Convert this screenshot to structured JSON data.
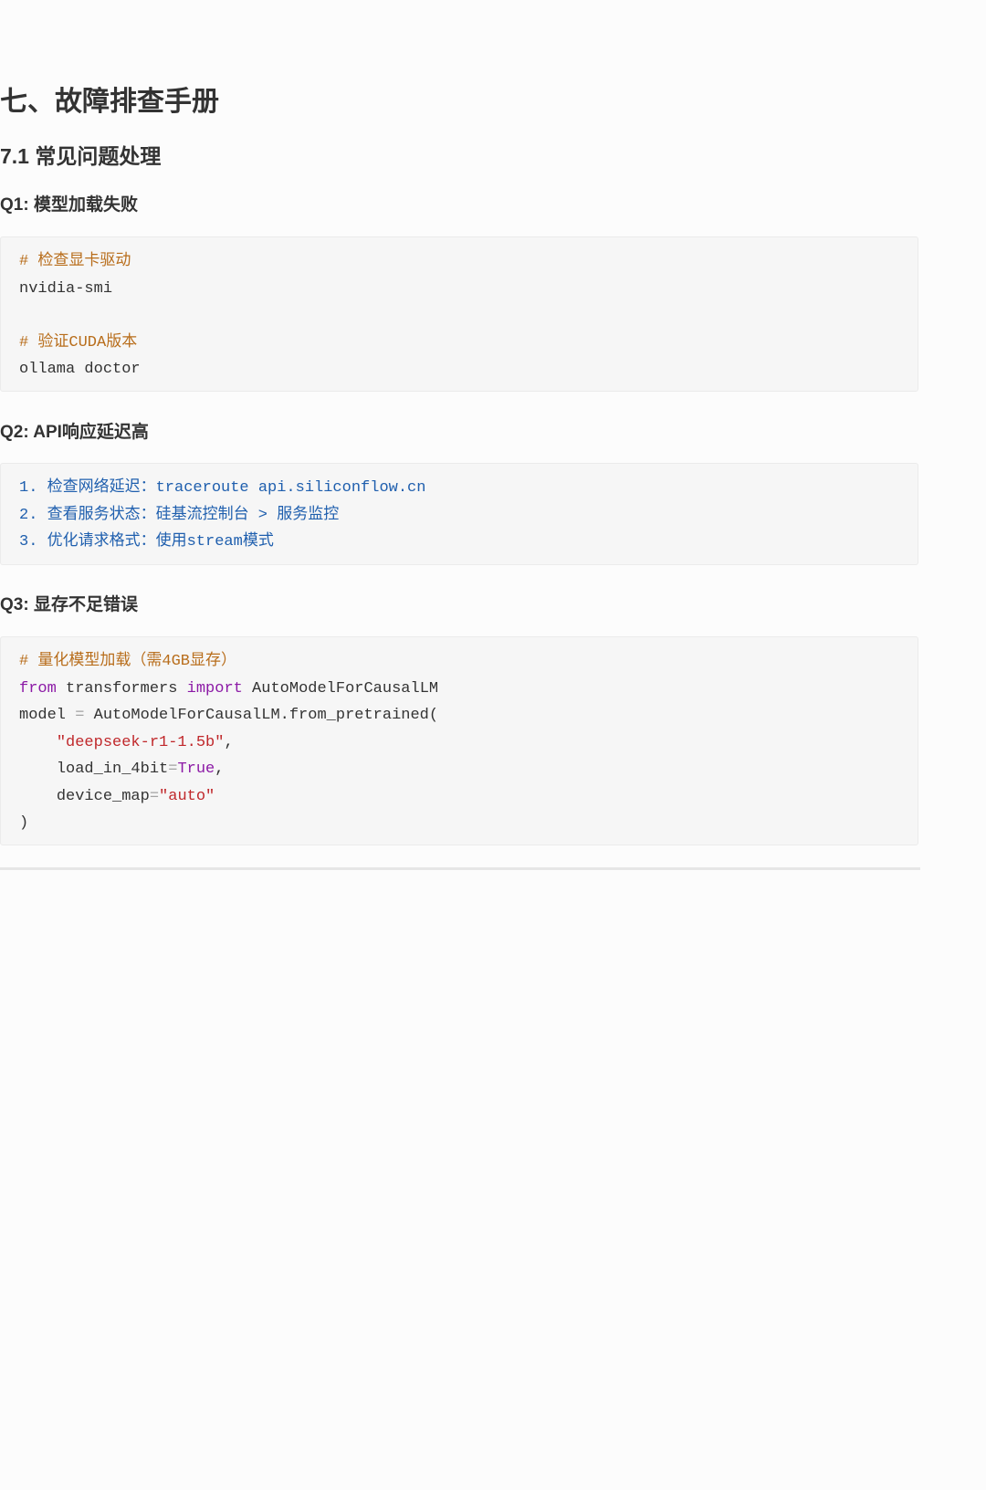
{
  "title": "七、故障排查手册",
  "section": "7.1 常见问题处理",
  "q1": {
    "heading": "Q1: 模型加载失败",
    "lines": [
      "# 检查显卡驱动",
      "nvidia-smi",
      "",
      "# 验证CUDA版本",
      "ollama doctor"
    ]
  },
  "q2": {
    "heading": "Q2: API响应延迟高",
    "lines": [
      "1. 检查网络延迟：traceroute api.siliconflow.cn",
      "2. 查看服务状态：硅基流控制台 > 服务监控",
      "3. 优化请求格式：使用stream模式"
    ]
  },
  "q3": {
    "heading": "Q3: 显存不足错误",
    "comment": "# 量化模型加载（需4GB显存）",
    "kw_from": "from",
    "module": " transformers ",
    "kw_import": "import",
    "cls": " AutoModelForCausalLM",
    "model_var": "model ",
    "eq": "=",
    "call": " AutoModelForCausalLM.from_pretrained(",
    "indent": "    ",
    "arg1": "\"deepseek-r1-1.5b\"",
    "comma": ",",
    "arg2_name": "load_in_4bit",
    "arg2_val": "True",
    "arg3_name": "device_map",
    "arg3_val": "\"auto\"",
    "close": ")"
  },
  "colors": {
    "comment": "#b86d1b",
    "keyword": "#8c1aa6",
    "string": "#c0282b",
    "list": "#1f5fae"
  }
}
